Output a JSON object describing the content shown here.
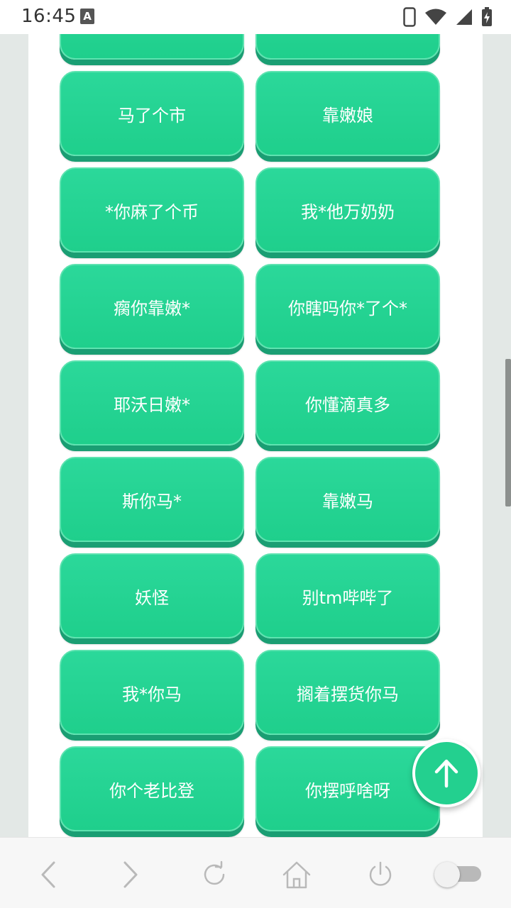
{
  "status_bar": {
    "time": "16:45",
    "notification_badge": "A"
  },
  "phrases": [
    "",
    "",
    "马了个市",
    "靠嫩娘",
    "*你麻了个币",
    "我*他万奶奶",
    "瘸你靠嫩*",
    "你瞎吗你*了个*",
    "耶沃日嫩*",
    "你懂滴真多",
    "斯你马*",
    "靠嫩马",
    "妖怪",
    "别tm哔哔了",
    "我*你马",
    "搁着摆货你马",
    "你个老比登",
    "你摆呼啥呀"
  ],
  "colors": {
    "button_green": "#23d08f",
    "button_shadow": "#1a9e73",
    "page_background": "#e3e8e6"
  },
  "bottom_nav": {
    "icons": [
      "back-icon",
      "forward-icon",
      "refresh-icon",
      "home-icon",
      "power-icon",
      "toggle-switch"
    ]
  }
}
